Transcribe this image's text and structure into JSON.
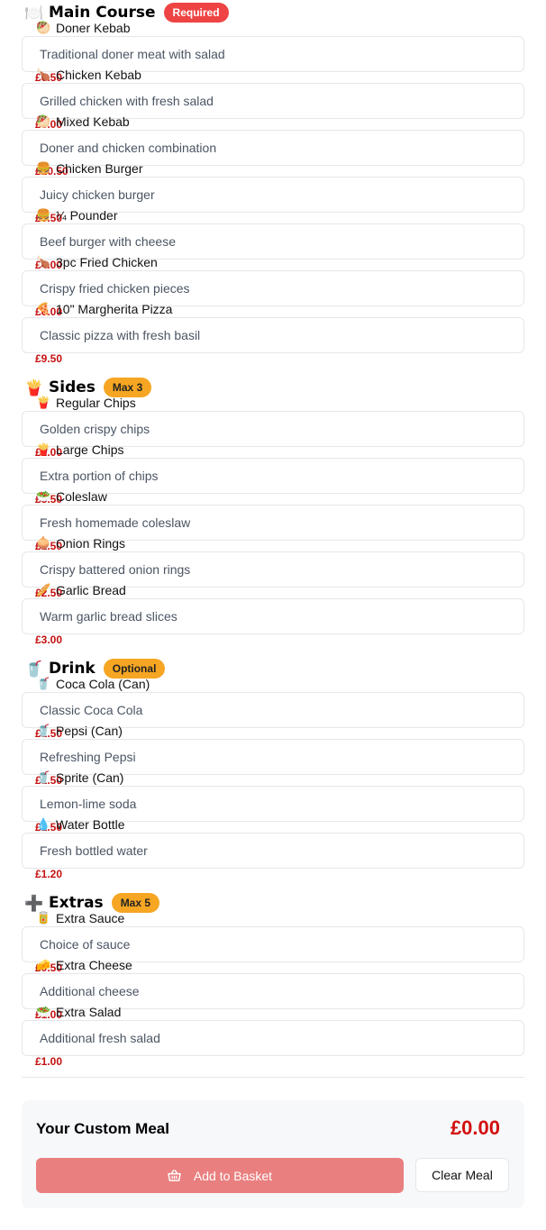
{
  "sections": [
    {
      "title": "Main Course",
      "icon": "🍽️",
      "icon_name": "plate-icon",
      "badge": "Required",
      "badge_color": "#ef4444",
      "items": [
        {
          "name": "Doner Kebab",
          "description": "Traditional doner meat with salad",
          "price": "£6.50",
          "icon": "🥙"
        },
        {
          "name": "Chicken Kebab",
          "description": "Grilled chicken with fresh salad",
          "price": "£6.00",
          "icon": "🍗"
        },
        {
          "name": "Mixed Kebab",
          "description": "Doner and chicken combination",
          "price": "£10.50",
          "icon": "🥙"
        },
        {
          "name": "Chicken Burger",
          "description": "Juicy chicken burger",
          "price": "£3.50",
          "icon": "🍔"
        },
        {
          "name": "¼ Pounder",
          "description": "Beef burger with cheese",
          "price": "£4.00",
          "icon": "🍔"
        },
        {
          "name": "3pc Fried Chicken",
          "description": "Crispy fried chicken pieces",
          "price": "£6.00",
          "icon": "🍗"
        },
        {
          "name": "10\" Margherita Pizza",
          "description": "Classic pizza with fresh basil",
          "price": "£9.50",
          "icon": "🍕"
        }
      ]
    },
    {
      "title": "Sides",
      "icon": "🍟",
      "icon_name": "fries-icon",
      "badge": "Max 3",
      "badge_color": "#f6a623",
      "items": [
        {
          "name": "Regular Chips",
          "description": "Golden crispy chips",
          "price": "£2.00",
          "icon": "🍟"
        },
        {
          "name": "Large Chips",
          "description": "Extra portion of chips",
          "price": "£3.50",
          "icon": "🍟"
        },
        {
          "name": "Coleslaw",
          "description": "Fresh homemade coleslaw",
          "price": "£1.50",
          "icon": "🥗"
        },
        {
          "name": "Onion Rings",
          "description": "Crispy battered onion rings",
          "price": "£2.50",
          "icon": "🧅"
        },
        {
          "name": "Garlic Bread",
          "description": "Warm garlic bread slices",
          "price": "£3.00",
          "icon": "🥖"
        }
      ]
    },
    {
      "title": "Drink",
      "icon": "🥤",
      "icon_name": "cup-icon",
      "badge": "Optional",
      "badge_color": "#f6a623",
      "items": [
        {
          "name": "Coca Cola (Can)",
          "description": "Classic Coca Cola",
          "price": "£1.50",
          "icon": "🥤"
        },
        {
          "name": "Pepsi (Can)",
          "description": "Refreshing Pepsi",
          "price": "£1.50",
          "icon": "🥤"
        },
        {
          "name": "Sprite (Can)",
          "description": "Lemon-lime soda",
          "price": "£1.50",
          "icon": "🥤"
        },
        {
          "name": "Water Bottle",
          "description": "Fresh bottled water",
          "price": "£1.20",
          "icon": "💧"
        }
      ]
    },
    {
      "title": "Extras",
      "icon": "➕",
      "icon_name": "plus-icon",
      "badge": "Max 5",
      "badge_color": "#f6a623",
      "items": [
        {
          "name": "Extra Sauce",
          "description": "Choice of sauce",
          "price": "£0.50",
          "icon": "🥫"
        },
        {
          "name": "Extra Cheese",
          "description": "Additional cheese",
          "price": "£1.00",
          "icon": "🧀"
        },
        {
          "name": "Extra Salad",
          "description": "Additional fresh salad",
          "price": "£1.00",
          "icon": "🥗"
        }
      ]
    }
  ],
  "summary": {
    "title": "Your Custom Meal",
    "total": "£0.00",
    "add_button_label": "Add to Basket",
    "add_button_icon": "basket-icon",
    "clear_button_label": "Clear Meal"
  },
  "colors": {
    "price": "#c51010",
    "total": "#d30f0f",
    "add_button": "#ea7f7f",
    "required_badge": "#ef4444",
    "optional_badge": "#f6a623"
  }
}
